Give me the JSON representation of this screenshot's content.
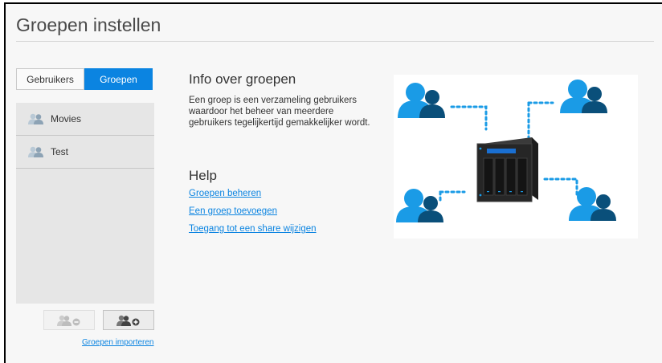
{
  "page": {
    "title": "Groepen instellen"
  },
  "tabs": [
    {
      "label": "Gebruikers",
      "active": false
    },
    {
      "label": "Groepen",
      "active": true
    }
  ],
  "groups": [
    {
      "name": "Movies"
    },
    {
      "name": "Test"
    }
  ],
  "buttons": {
    "remove_group_icon": "remove-group-icon",
    "add_group_icon": "add-group-icon",
    "import_label": "Groepen importeren"
  },
  "info": {
    "title": "Info over groepen",
    "text": "Een groep is een verzameling gebruikers waardoor het beheer van meerdere gebruikers tegelijkertijd gemakkelijker wordt."
  },
  "help": {
    "title": "Help",
    "links": [
      "Groepen beheren",
      "Een groep toevoegen",
      "Toegang tot een share wijzigen"
    ]
  },
  "colors": {
    "accent": "#0b84e1",
    "user_blue": "#1a9be6",
    "user_dark": "#0a4f7a"
  }
}
